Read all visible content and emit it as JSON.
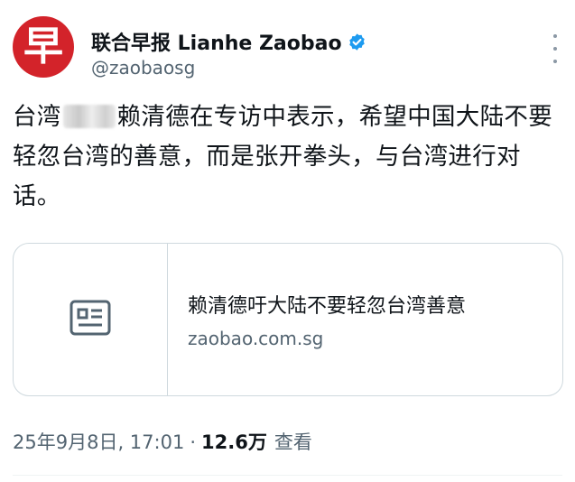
{
  "author": {
    "avatar_glyph": "早",
    "display_name": "联合早报 Lianhe Zaobao",
    "handle": "@zaobaosg",
    "verified": true
  },
  "tweet": {
    "text_part1": "台湾",
    "text_part2": "赖清德在专访中表示，希望中国大陆不要轻忽台湾的善意，而是张开拳头，与台湾进行对话。"
  },
  "link_card": {
    "title": "赖清德吁大陆不要轻忽台湾善意",
    "domain": "zaobao.com.sg",
    "thumbnail_icon": "news-article-icon"
  },
  "meta": {
    "date_time": "25年9月8日, 17:01",
    "separator": "·",
    "views_count": "12.6万",
    "views_label": "查看"
  },
  "colors": {
    "avatar_red": "#d3232a",
    "verified_blue": "#1d9bf0",
    "text_primary": "#0f1419",
    "text_secondary": "#536471",
    "border": "#cfd9de"
  }
}
